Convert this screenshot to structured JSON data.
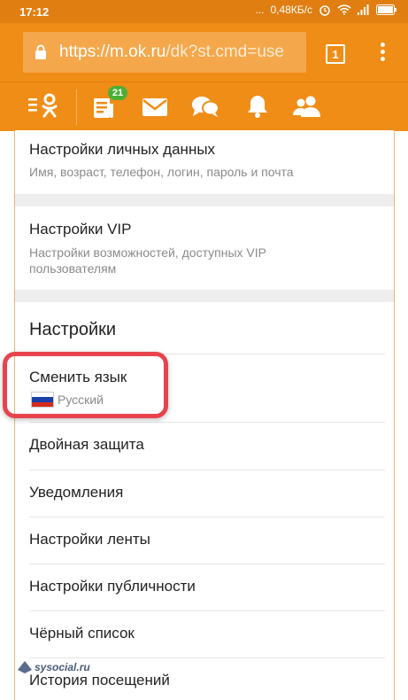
{
  "status_bar": {
    "time": "17:12",
    "dots": "...",
    "speed": "0,48КБ/с",
    "battery_color": "#ffffff"
  },
  "browser": {
    "url_host": "https://m.ok.ru",
    "url_path": "/dk?st.cmd=usе",
    "tab_count": "1",
    "accent_color": "#ef8d17"
  },
  "ok_toolbar": {
    "icons": [
      "ok-logo-menu-icon",
      "feed-icon",
      "messages-icon",
      "discussions-icon",
      "notifications-icon",
      "friends-icon"
    ],
    "feed_badge": "21"
  },
  "settings": {
    "personal": {
      "title": "Настройки личных данных",
      "subtitle": "Имя, возраст, телефон, логин, пароль и почта"
    },
    "vip": {
      "title": "Настройки VIP",
      "subtitle_line1": "Настройки возможностей, доступных VIP",
      "subtitle_line2": "пользователям"
    },
    "section_title": "Настройки",
    "language": {
      "title": "Сменить язык",
      "value": "Русский"
    },
    "items": [
      "Двойная защита",
      "Уведомления",
      "Настройки ленты",
      "Настройки публичности",
      "Чёрный список",
      "История посещений"
    ]
  },
  "watermark": "sysocial.ru",
  "highlight_color": "#e8434d"
}
